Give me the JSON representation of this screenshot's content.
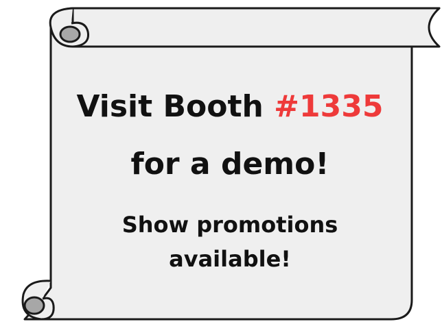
{
  "banner": {
    "line1_prefix": "Visit Booth ",
    "booth_number": "#1335",
    "line2": "for a demo!",
    "line3": "Show promotions",
    "line4": "available!"
  },
  "colors": {
    "paper": "#efefef",
    "outline": "#1a1a1a",
    "accent_red": "#ee3a3a",
    "text": "#111111"
  },
  "icons": {
    "artwork": "scroll-icon"
  }
}
